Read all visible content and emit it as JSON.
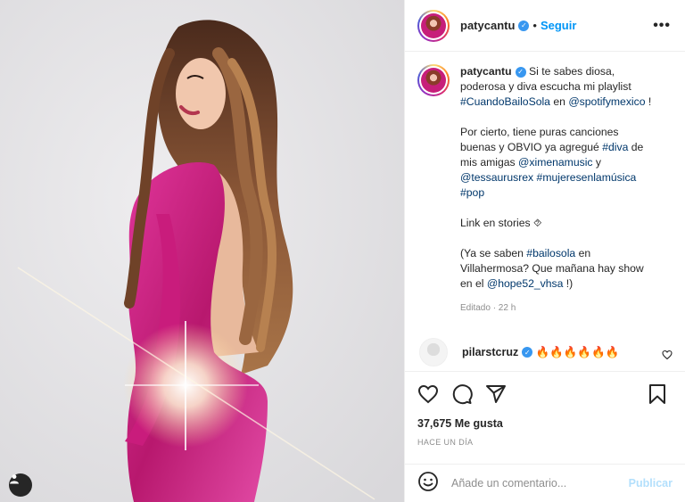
{
  "post": {
    "username": "patycantu",
    "follow_label": "Seguir",
    "separator": "•",
    "more_label": "•••",
    "caption_lines": [
      {
        "text": "Si te sabes diosa,"
      },
      {
        "text": "poderosa y diva escucha mi playlist"
      }
    ],
    "caption": {
      "l1": "Si te sabes diosa,",
      "l2": "poderosa y diva escucha mi playlist",
      "tag1": "#CuandoBailoSola",
      "l3_mid": " en ",
      "mention1": "@spotifymexico",
      "l3_end": " !",
      "l4": "Por cierto, tiene puras canciones",
      "l5": "buenas y OBVIO ya agregué ",
      "tag2": "#diva",
      "l5_end": " de",
      "l6": "mis amigas ",
      "mention2": "@ximenamusic",
      "l6_end": " y",
      "mention3": "@tessaurusrex",
      "tag3": "#mujeresenlamúsica",
      "tag4": "#pop",
      "l7": "Link en stories ⯑",
      "l8_start": "(Ya se saben ",
      "tag5": "#bailosola",
      "l8_end": " en",
      "l9": "Villahermosa? Que mañana hay show",
      "l10_start": "en el ",
      "mention4": "@hope52_vhsa",
      "l10_end": " !)"
    },
    "edited_time": "Editado · 22 h",
    "likes": "37,675 Me gusta",
    "posted_ago": "Hace un día"
  },
  "comment": {
    "username": "pilarstcruz",
    "text": "🔥🔥🔥🔥🔥🔥"
  },
  "add_comment": {
    "placeholder": "Añade un comentario...",
    "publish_label": "Publicar"
  },
  "colors": {
    "accent_blue": "#0095f6",
    "link_blue": "#00376b",
    "muted": "#8e8e8e",
    "dress_pink": "#c71e7a"
  },
  "icons": [
    "verified-badge-icon",
    "more-options-icon",
    "heart-icon",
    "comment-icon",
    "share-icon",
    "bookmark-icon",
    "emoji-icon",
    "tag-user-icon"
  ]
}
